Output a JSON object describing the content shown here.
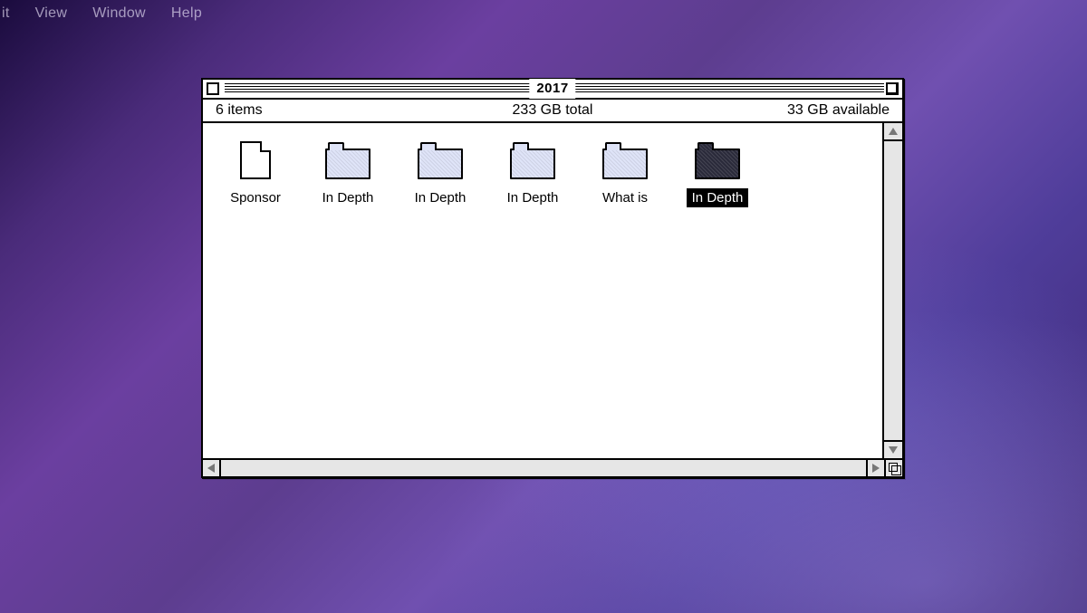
{
  "menubar": {
    "items": [
      "it",
      "View",
      "Window",
      "Help"
    ]
  },
  "window": {
    "title": "2017",
    "status": {
      "items": "6 items",
      "total": "233 GB total",
      "available": "33 GB available"
    },
    "items": [
      {
        "type": "document",
        "label": "Sponsor",
        "selected": false
      },
      {
        "type": "folder",
        "label": "In Depth",
        "selected": false
      },
      {
        "type": "folder",
        "label": "In Depth",
        "selected": false
      },
      {
        "type": "folder",
        "label": "In Depth",
        "selected": false
      },
      {
        "type": "folder",
        "label": "What is",
        "selected": false
      },
      {
        "type": "folder",
        "label": "In Depth",
        "selected": true
      }
    ]
  }
}
